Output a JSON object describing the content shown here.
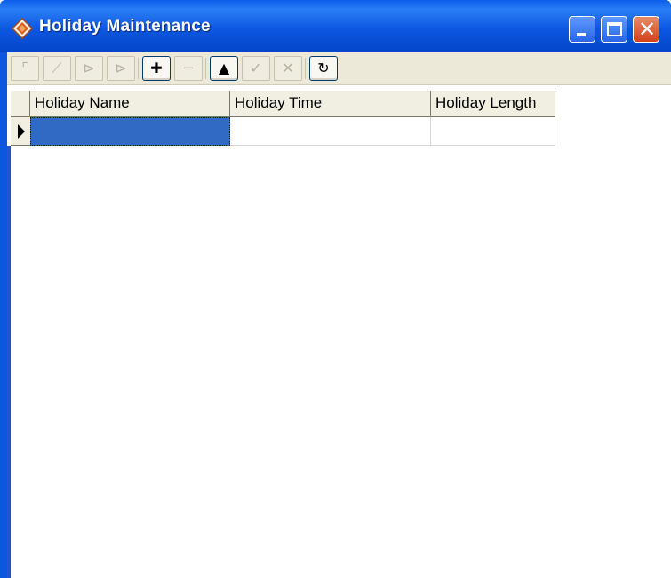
{
  "window": {
    "title": "Holiday Maintenance",
    "icon": "diamond-app-icon",
    "caption_buttons": [
      "minimize-icon",
      "maximize-icon",
      "close-icon"
    ]
  },
  "toolbar": {
    "buttons": [
      {
        "name": "first-record",
        "icon": "first-record-icon",
        "glyph": "⌜",
        "enabled": false
      },
      {
        "name": "prior-record",
        "icon": "prior-record-icon",
        "glyph": "⟋",
        "enabled": false
      },
      {
        "name": "next-record",
        "icon": "next-record-icon",
        "glyph": "⊳",
        "enabled": false
      },
      {
        "name": "last-record",
        "icon": "last-record-icon",
        "glyph": "⊳",
        "enabled": false
      },
      {
        "name": "insert",
        "icon": "plus-icon",
        "glyph": "✚",
        "enabled": true
      },
      {
        "name": "delete",
        "icon": "minus-icon",
        "glyph": "─",
        "enabled": false
      },
      {
        "name": "edit",
        "icon": "triangle-up-icon",
        "glyph": "▲",
        "enabled": true
      },
      {
        "name": "post",
        "icon": "check-icon",
        "glyph": "✓",
        "enabled": false
      },
      {
        "name": "cancel",
        "icon": "cross-icon",
        "glyph": "✕",
        "enabled": false
      },
      {
        "name": "refresh",
        "icon": "refresh-icon",
        "glyph": "↻",
        "enabled": true
      }
    ]
  },
  "grid": {
    "columns": [
      "Holiday Name",
      "Holiday Time",
      "Holiday Length"
    ],
    "rows": [
      {
        "cells": [
          "",
          "",
          ""
        ],
        "current": true
      }
    ]
  },
  "colors": {
    "titlebar": "#0a5ee8",
    "selection": "#316ac5",
    "toolbar_bg": "#ece9d8",
    "close_button": "#d2431a"
  }
}
